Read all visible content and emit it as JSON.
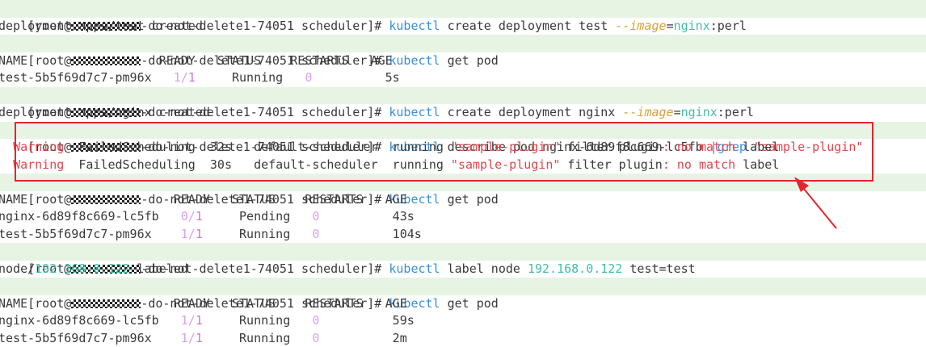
{
  "prompt": {
    "open": "[root@",
    "host_suffix": "-do-not-delete1-74051",
    "dir": " scheduler]# "
  },
  "lines": {
    "l1": {
      "cmd": "kubectl",
      "rest1": " create deployment test ",
      "flag": "--image",
      "eq": "=",
      "val": "nginx",
      "rest2": ":perl"
    },
    "l2": "deployment.apps/test created",
    "l3": {
      "cmd": "kubectl",
      "rest": " get pod"
    },
    "l4": "NAME                  READY   STATUS    RESTARTS   AGE",
    "l5": {
      "name": "test-5b5f69d7c7-pm96x   ",
      "ready_a": "1/",
      "ready_b": "1",
      "status": "     Running   ",
      "restarts": "0",
      "age": "          5s"
    },
    "l6": {
      "cmd": "kubectl",
      "rest1": " create deployment nginx ",
      "flag": "--image",
      "eq": "=",
      "val": "nginx",
      "rest2": ":perl"
    },
    "l7": "deployment.apps/nginx created",
    "l8": {
      "cmd": "kubectl",
      "rest1": " describe pod nginx-6d89f8c669-lc5fb ",
      "pipe": "|grep ",
      "str": "\"sample-plugin\""
    },
    "l9": {
      "warn": "Warning",
      "rest1": "  FailedScheduling  32s   default-scheduler  running ",
      "str": "\"sample-plugin\"",
      "rest2": " filter plugin",
      "colon": ":",
      "nomatch": " no match",
      "rest3": " label"
    },
    "l10": {
      "warn": "Warning",
      "rest1": "  FailedScheduling  30s   default-scheduler  running ",
      "str": "\"sample-plugin\"",
      "rest2": " filter plugin",
      "colon": ":",
      "nomatch": " no match",
      "rest3": " label"
    },
    "l11": {
      "cmd": "kubectl",
      "rest": " get pod"
    },
    "l12": "NAME                    READY   STATUS    RESTARTS   AGE",
    "l13": {
      "name": "nginx-6d89f8c669-lc5fb   ",
      "ready_a": "0/",
      "ready_b": "1",
      "status": "     Pending   ",
      "restarts": "0",
      "age": "          43s"
    },
    "l14": {
      "name": "test-5b5f69d7c7-pm96x    ",
      "ready_a": "1/",
      "ready_b": "1",
      "status": "     Running   ",
      "restarts": "0",
      "age": "          104s"
    },
    "l15": {
      "cmd": "kubectl",
      "rest1": " label node ",
      "ip": "192.168.0.122",
      "rest2": " test=test"
    },
    "l16": {
      "pre": "node/",
      "ip": "192.168.0.122",
      "rest": " labeled"
    },
    "l17": {
      "cmd": "kubectl",
      "rest": " get pod"
    },
    "l18": "NAME                    READY   STATUS    RESTARTS   AGE",
    "l19": {
      "name": "nginx-6d89f8c669-lc5fb   ",
      "ready_a": "1/",
      "ready_b": "1",
      "status": "     Running   ",
      "restarts": "0",
      "age": "          59s"
    },
    "l20": {
      "name": "test-5b5f69d7c7-pm96x    ",
      "ready_a": "1/",
      "ready_b": "1",
      "status": "     Running   ",
      "restarts": "0",
      "age": "          2m"
    }
  },
  "colors": {
    "prompt_bg": "#e7f4e4",
    "command": "#3a8fd9",
    "flag": "#d9a13a",
    "value": "#3fbfa6",
    "warning": "#e0454c",
    "annotation": "#e3262c"
  }
}
